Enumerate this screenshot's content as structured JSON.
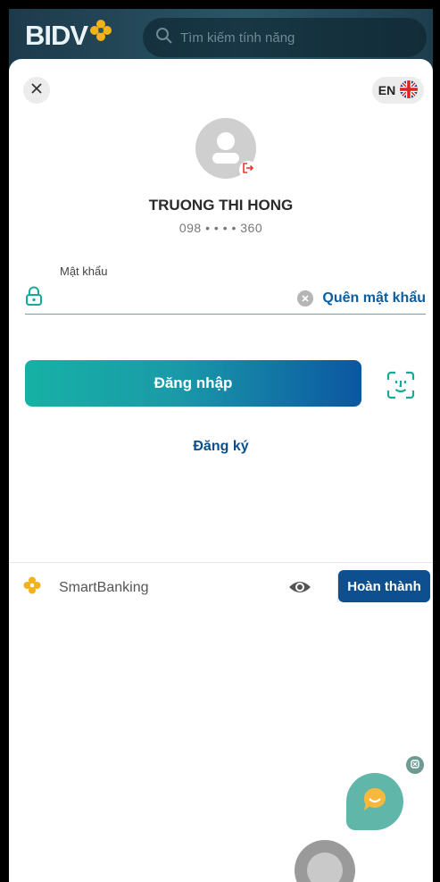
{
  "header": {
    "logo_text": "BIDV",
    "search_placeholder": "Tìm kiếm tính năng"
  },
  "login": {
    "language": "EN",
    "user_name": "TRUONG THI HONG",
    "phone_masked": "098 • • • • 360",
    "password_label": "Mật khẩu",
    "password_value": "",
    "forgot_label": "Quên mật khẩu",
    "login_label": "Đăng nhập",
    "register_label": "Đăng ký"
  },
  "keyboard_bar": {
    "title": "SmartBanking",
    "done_label": "Hoàn thành"
  },
  "colors": {
    "primary": "#0b5fa0",
    "gradient_start": "#16b1a4",
    "gradient_end": "#0b56a1",
    "logo_gold": "#f2b21b",
    "badge_red": "#e53935"
  },
  "icons": [
    "close-icon",
    "uk-flag-icon",
    "user-icon",
    "logout-icon",
    "lock-icon",
    "clear-icon",
    "face-id-icon",
    "bidv-logo-icon",
    "eye-icon",
    "chat-icon",
    "search-icon"
  ]
}
